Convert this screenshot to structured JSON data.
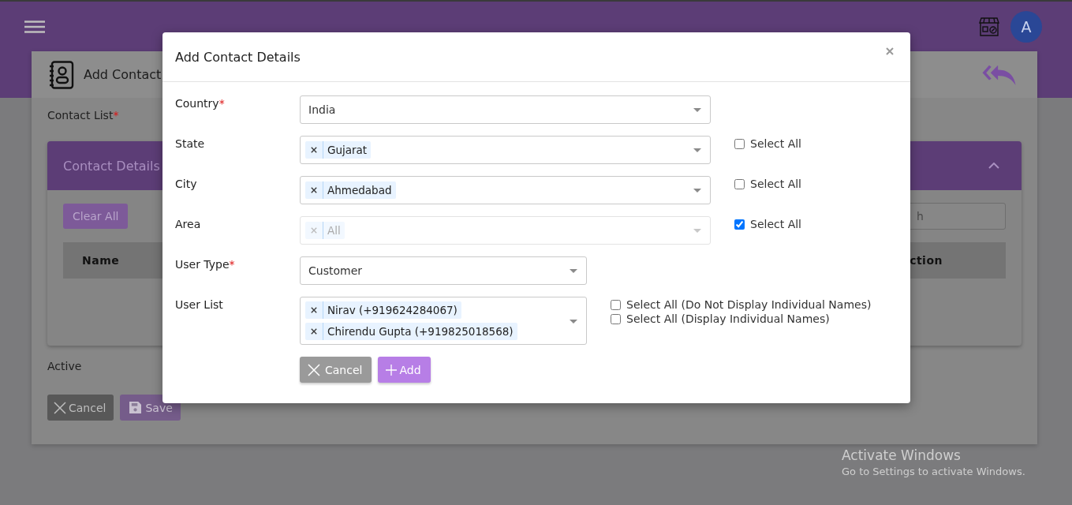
{
  "topbar": {
    "avatar": "A"
  },
  "page": {
    "title": "Add Contact",
    "contact_list": {
      "label": "Contact List",
      "required_mark": "*"
    },
    "panel": {
      "title": "Contact Details",
      "expanded": true,
      "clear_button": "Clear All",
      "search_placeholder": "h",
      "columns": [
        "Name",
        "ction"
      ]
    },
    "active_label": "Active",
    "buttons": [
      {
        "label": "Cancel",
        "kind": "cancel",
        "disabled": false
      },
      {
        "label": "Save",
        "kind": "save",
        "disabled": true
      }
    ]
  },
  "modal": {
    "title": "Add Contact Details",
    "location_fields": [
      {
        "label": "Country",
        "required_mark": "*",
        "kind": "select",
        "value": "India",
        "disabled": false
      },
      {
        "label": "State",
        "kind": "multi",
        "tags": [
          "Gujarat"
        ],
        "disabled": false,
        "select_all": [
          {
            "label": "Select All",
            "checked": false
          }
        ]
      },
      {
        "label": "City",
        "kind": "multi",
        "tags": [
          "Ahmedabad"
        ],
        "disabled": false,
        "select_all": [
          {
            "label": "Select All",
            "checked": false
          }
        ]
      },
      {
        "label": "Area",
        "kind": "multi",
        "tags": [
          "All"
        ],
        "disabled": true,
        "select_all": [
          {
            "label": "Select All",
            "checked": true
          }
        ]
      }
    ],
    "user_fields": [
      {
        "label": "User Type",
        "required_mark": "*",
        "kind": "select",
        "value": "Customer",
        "disabled": false
      },
      {
        "label": "User List",
        "kind": "multi",
        "tags": [
          "Nirav (+919624284067)",
          "Chirendu Gupta (+919825018568)"
        ],
        "disabled": false,
        "select_all": [
          {
            "label": "Select All (Do Not Display Individual Names)",
            "checked": false
          },
          {
            "label": "Select All (Display Individual Names)",
            "checked": false
          }
        ]
      }
    ],
    "buttons": [
      {
        "label": "Cancel",
        "kind": "cancel"
      },
      {
        "label": "Add",
        "kind": "add"
      }
    ]
  },
  "os_notice": {
    "title": "Activate Windows",
    "text": "Go to Settings to activate Windows."
  }
}
